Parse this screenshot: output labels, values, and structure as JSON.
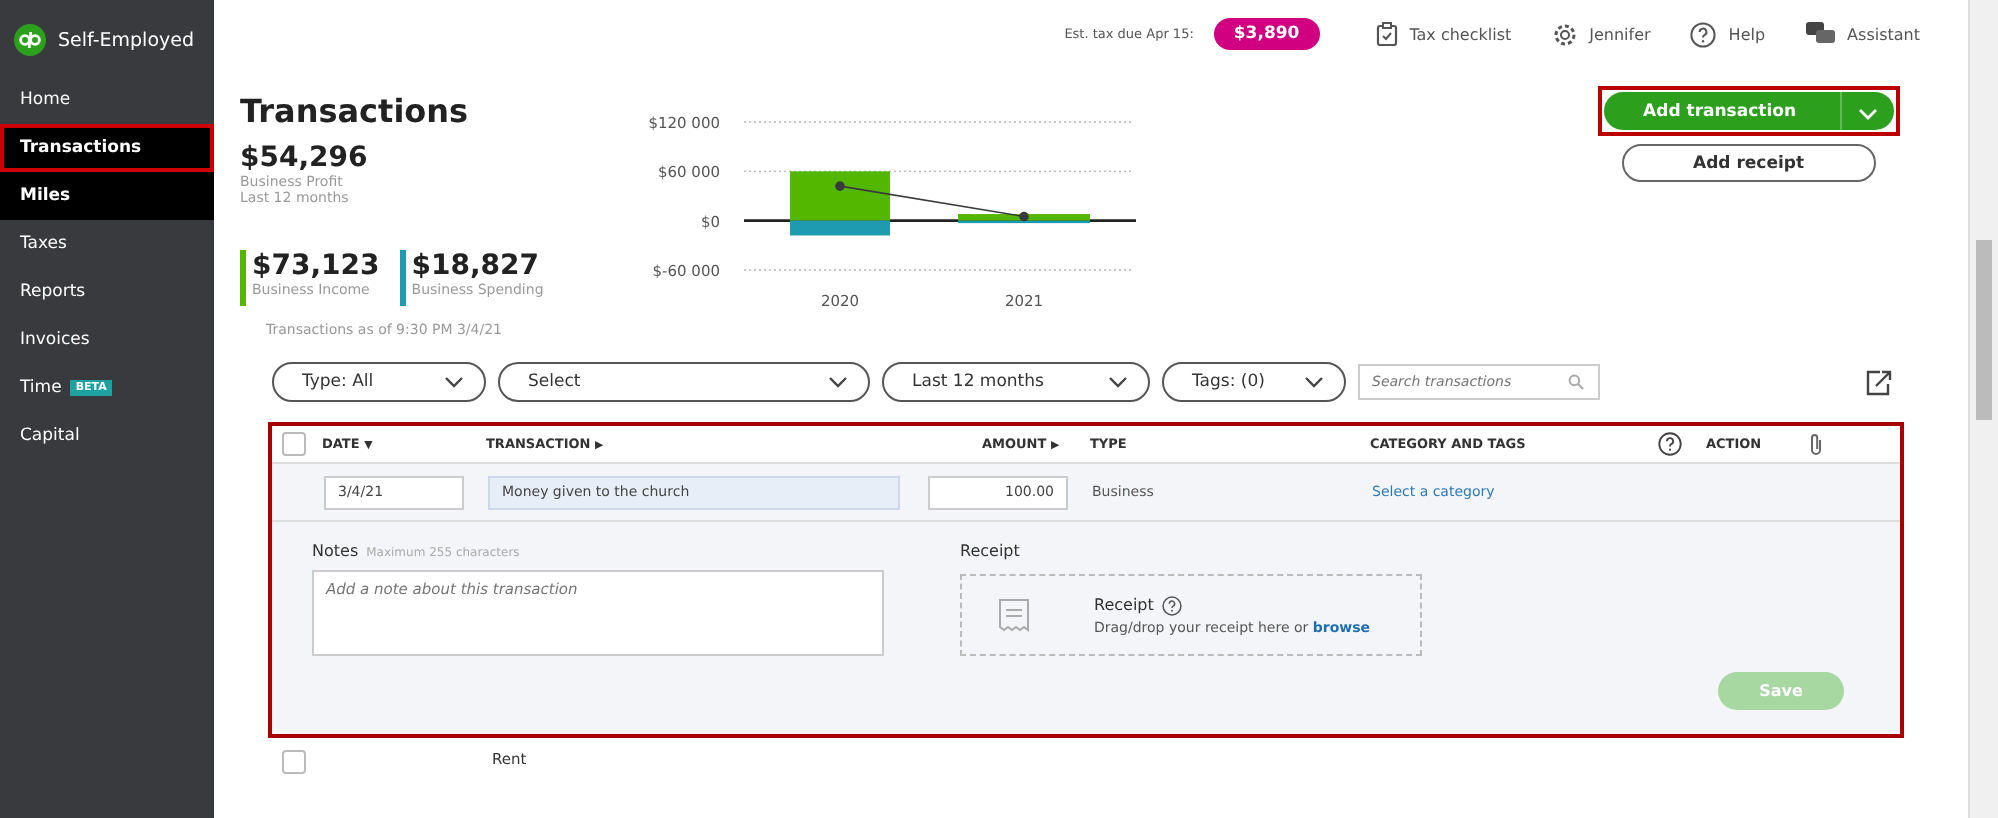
{
  "app": {
    "name": "Self-Employed"
  },
  "sidebar": {
    "items": [
      {
        "label": "Home",
        "selected": false,
        "hovered": false
      },
      {
        "label": "Transactions",
        "selected": true,
        "hovered": false
      },
      {
        "label": "Miles",
        "selected": false,
        "hovered": true
      },
      {
        "label": "Taxes",
        "selected": false,
        "hovered": false
      },
      {
        "label": "Reports",
        "selected": false,
        "hovered": false
      },
      {
        "label": "Invoices",
        "selected": false,
        "hovered": false
      },
      {
        "label": "Time",
        "badge": "BETA",
        "selected": false,
        "hovered": false
      },
      {
        "label": "Capital",
        "selected": false,
        "hovered": false
      }
    ]
  },
  "topbar": {
    "tax_label": "Est. tax due Apr 15:",
    "tax_amount": "$3,890",
    "links": [
      {
        "kind": "checklist",
        "label": "Tax checklist"
      },
      {
        "kind": "gear",
        "label": "Jennifer"
      },
      {
        "kind": "help",
        "label": "Help"
      },
      {
        "kind": "chat",
        "label": "Assistant"
      }
    ]
  },
  "page": {
    "title": "Transactions",
    "add_transaction": "Add transaction",
    "add_receipt": "Add receipt"
  },
  "summary": {
    "profit": "$54,296",
    "profit_label": "Business Profit",
    "period": "Last 12 months",
    "stats": [
      {
        "value": "$73,123",
        "label": "Business Income",
        "color": "#53b700"
      },
      {
        "value": "$18,827",
        "label": "Business Spending",
        "color": "#1e9bb0"
      }
    ]
  },
  "chart": {
    "chart_data": {
      "type": "bar",
      "categories": [
        "2020",
        "2021"
      ],
      "stacked": true,
      "ylim": [
        -60000,
        120000
      ],
      "yticks": [
        {
          "value": 120000,
          "label": "$120 000"
        },
        {
          "value": 60000,
          "label": "$60 000"
        },
        {
          "value": 0,
          "label": "$0"
        },
        {
          "value": -60000,
          "label": "$-60 000"
        }
      ],
      "series": [
        {
          "type": "bar",
          "color": "#53b700",
          "values": [
            60000,
            8000
          ]
        },
        {
          "type": "bar",
          "color": "#1e9bb0",
          "values": [
            -18000,
            -3000
          ]
        },
        {
          "type": "line",
          "marker": true,
          "color": "#393a3d",
          "values": [
            42000,
            5000
          ]
        }
      ]
    }
  },
  "as_of": "Transactions as of 9:30 PM 3/4/21",
  "filters": [
    {
      "label": "Type: All"
    },
    {
      "label": "Select"
    },
    {
      "label": "Last 12 months"
    },
    {
      "label": "Tags: (0)"
    }
  ],
  "search": {
    "placeholder": "Search transactions"
  },
  "table": {
    "all_checked": false,
    "columns": [
      {
        "label": "DATE",
        "sort": "▼"
      },
      {
        "label": "TRANSACTION",
        "sort": "▶"
      },
      {
        "label": "AMOUNT",
        "sort": "▶"
      },
      {
        "label": "TYPE"
      },
      {
        "label": "CATEGORY AND TAGS"
      },
      {
        "label": "ACTION"
      }
    ],
    "edit_row": {
      "date": "3/4/21",
      "transaction": "Money given to the church",
      "amount": "100.00",
      "type": "Business",
      "category_link": "Select a category",
      "notes_label": "Notes",
      "notes_hint": "Maximum 255 characters",
      "notes_placeholder": "Add a note about this transaction",
      "receipt_label": "Receipt",
      "receipt_title": "Receipt",
      "receipt_text": "Drag/drop your receipt here or **browse**",
      "save": "Save",
      "save_disabled": true
    },
    "rows": [
      {
        "checked": false,
        "transaction": "Rent"
      }
    ]
  }
}
